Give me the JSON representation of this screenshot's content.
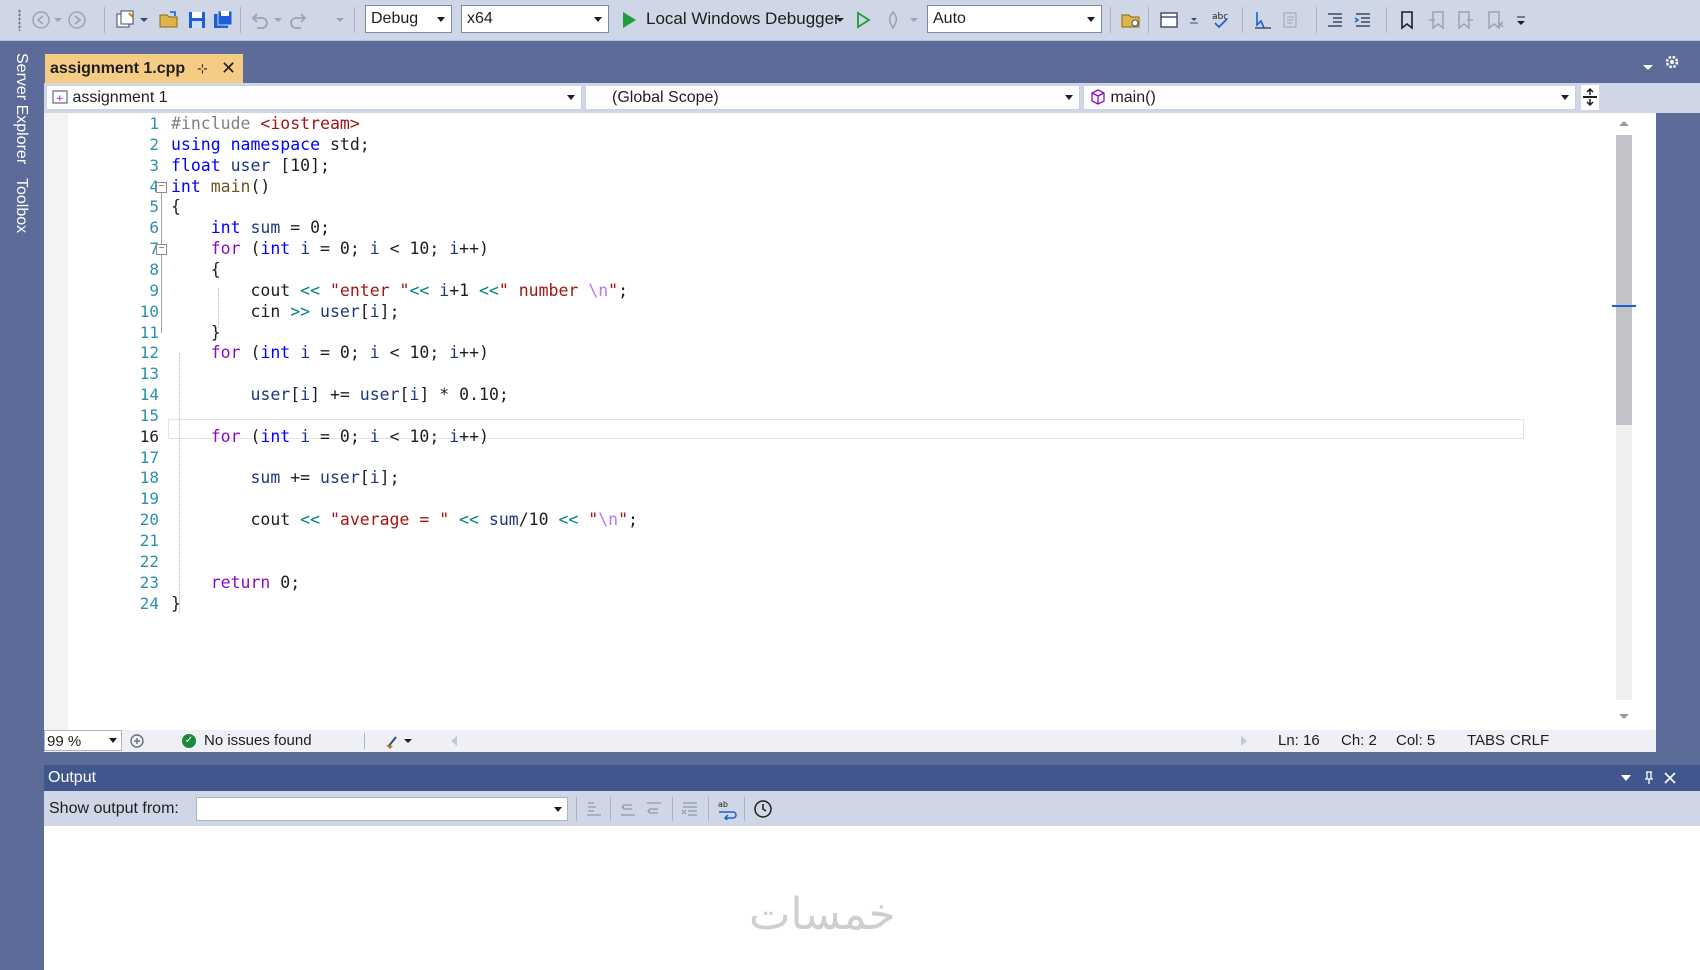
{
  "toolbar": {
    "configuration": "Debug",
    "platform": "x64",
    "debugger_label": "Local Windows Debugger",
    "auto_combo": "Auto",
    "icons": [
      "back-icon",
      "forward-icon",
      "new-project-icon",
      "open-folder-icon",
      "save-icon",
      "save-all-icon",
      "undo-icon",
      "redo-icon",
      "start-debug-icon",
      "start-without-debug-icon",
      "hot-reload-icon",
      "solution-explorer-icon",
      "browse-icon",
      "spell-check-icon",
      "step-icon",
      "comment-icon",
      "indent-icon",
      "outdent-icon",
      "bookmark-icon"
    ]
  },
  "sidebar": {
    "items": [
      "Server Explorer",
      "Toolbox"
    ]
  },
  "document_tab": {
    "label": "assignment 1.cpp",
    "pin_glyph": "⊹",
    "close_glyph": "✕"
  },
  "navbar": {
    "project": "assignment 1",
    "scope": "(Global Scope)",
    "member": "main()"
  },
  "editor": {
    "current_line": 16,
    "line_numbers": [
      "1",
      "2",
      "3",
      "4",
      "5",
      "6",
      "7",
      "8",
      "9",
      "10",
      "11",
      "12",
      "13",
      "14",
      "15",
      "16",
      "17",
      "18",
      "19",
      "20",
      "21",
      "22",
      "23",
      "24"
    ],
    "lines": [
      "#include <iostream>",
      "using namespace std;",
      "float user [10];",
      "int main()",
      "{",
      "    int sum = 0;",
      "    for (int i = 0; i < 10; i++)",
      "    {",
      "        cout << \"enter \"<< i+1 <<\" number \\n\";",
      "        cin >> user[i];",
      "    }",
      "    for (int i = 0; i < 10; i++)",
      "",
      "        user[i] += user[i] * 0.10;",
      "",
      "    for (int i = 0; i < 10; i++)",
      "",
      "        sum += user[i];",
      "",
      "        cout << \"average = \" << sum/10 << \"\\n\";",
      "",
      "",
      "    return 0;",
      "}"
    ]
  },
  "status_bar": {
    "zoom": "99 %",
    "issues": "No issues found",
    "ln": "Ln: 16",
    "ch": "Ch: 2",
    "col": "Col: 5",
    "tabs": "TABS",
    "eol": "CRLF"
  },
  "output": {
    "title": "Output",
    "show_from_label": "Show output from:",
    "show_from_value": "",
    "watermark": "خمسات"
  }
}
